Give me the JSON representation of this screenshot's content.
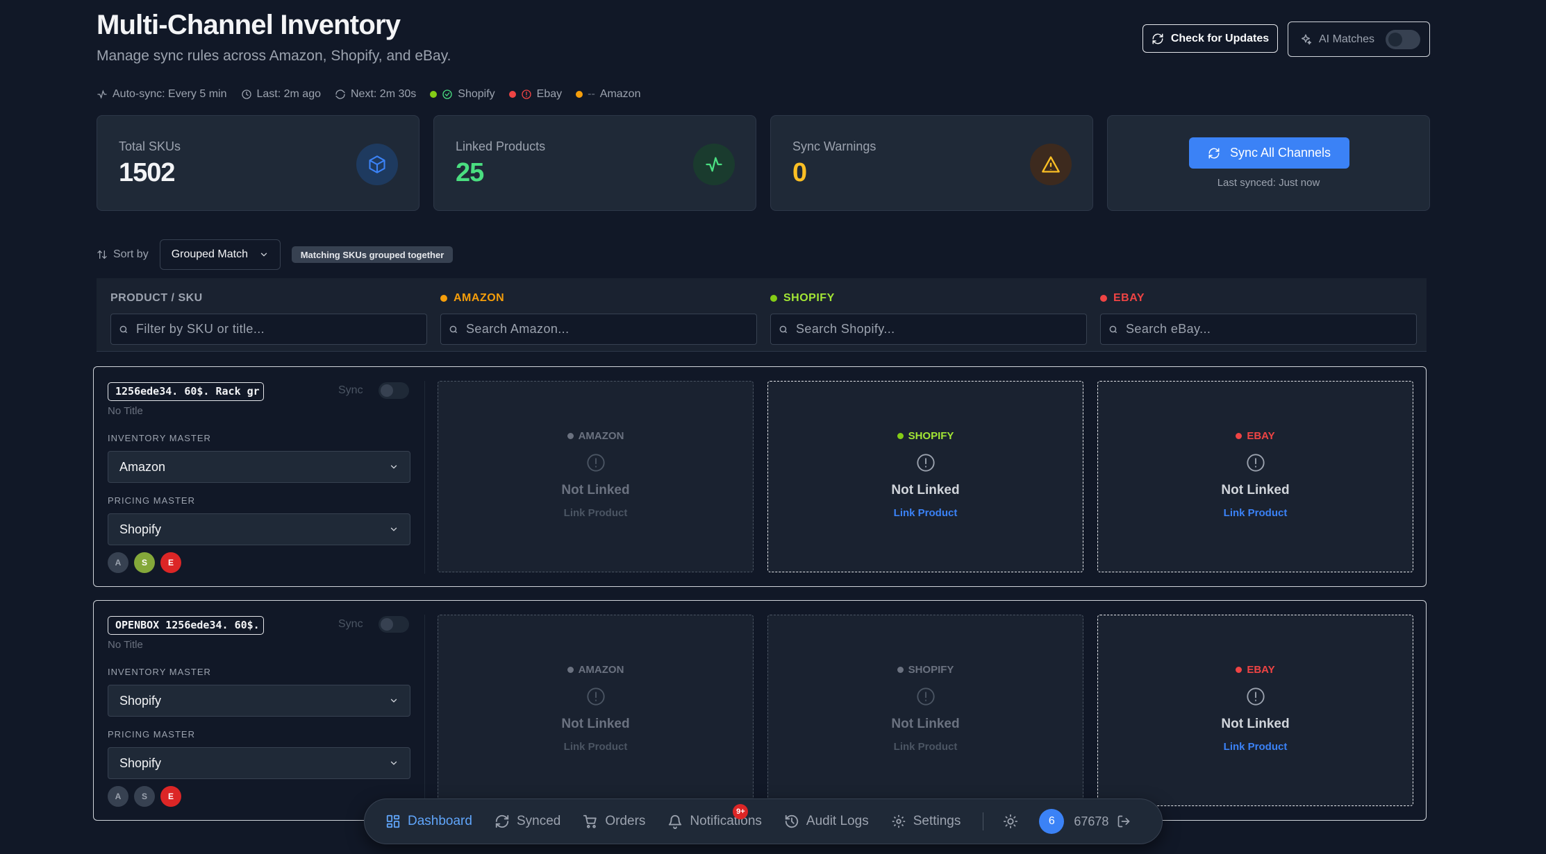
{
  "header": {
    "title": "Multi-Channel Inventory",
    "subtitle": "Manage sync rules across Amazon, Shopify, and eBay.",
    "check_updates_label": "Check for Updates",
    "ai_matches_label": "AI Matches"
  },
  "status": {
    "auto_sync": "Auto-sync: Every 5 min",
    "last": "Last: 2m ago",
    "next": "Next: 2m 30s",
    "shopify": "Shopify",
    "ebay": "Ebay",
    "amazon_prefix": "--",
    "amazon": "Amazon"
  },
  "stats": {
    "total_skus_label": "Total SKUs",
    "total_skus_value": "1502",
    "linked_label": "Linked Products",
    "linked_value": "25",
    "warnings_label": "Sync Warnings",
    "warnings_value": "0",
    "sync_all_label": "Sync All Channels",
    "last_synced": "Last synced: Just now"
  },
  "sort": {
    "label": "Sort by",
    "selected": "Grouped Match",
    "chip": "Matching SKUs grouped together"
  },
  "filters": {
    "product_head": "PRODUCT / SKU",
    "product_placeholder": "Filter by SKU or title...",
    "amazon_head": "AMAZON",
    "amazon_placeholder": "Search Amazon...",
    "shopify_head": "SHOPIFY",
    "shopify_placeholder": "Search Shopify...",
    "ebay_head": "EBAY",
    "ebay_placeholder": "Search eBay..."
  },
  "groups": [
    {
      "sku": "1256ede34. 60$. Rack gr",
      "sync_label": "Sync",
      "title": "No Title",
      "inventory_master_label": "INVENTORY MASTER",
      "inventory_master": "Amazon",
      "pricing_master_label": "PRICING MASTER",
      "pricing_master": "Shopify",
      "avatars": [
        "A",
        "S",
        "E"
      ],
      "slots": [
        {
          "channel": "AMAZON",
          "status": "Not Linked",
          "action": "Link Product"
        },
        {
          "channel": "SHOPIFY",
          "status": "Not Linked",
          "action": "Link Product"
        },
        {
          "channel": "EBAY",
          "status": "Not Linked",
          "action": "Link Product"
        }
      ]
    },
    {
      "sku": "OPENBOX 1256ede34. 60$.",
      "sync_label": "Sync",
      "title": "No Title",
      "inventory_master_label": "INVENTORY MASTER",
      "inventory_master": "Shopify",
      "pricing_master_label": "PRICING MASTER",
      "pricing_master": "Shopify",
      "avatars": [
        "A",
        "S",
        "E"
      ],
      "slots": [
        {
          "channel": "AMAZON",
          "status": "Not Linked",
          "action": "Link Product"
        },
        {
          "channel": "SHOPIFY",
          "status": "Not Linked",
          "action": "Link Product"
        },
        {
          "channel": "EBAY",
          "status": "Not Linked",
          "action": "Link Product"
        }
      ]
    }
  ],
  "nav": {
    "dashboard": "Dashboard",
    "synced": "Synced",
    "orders": "Orders",
    "notifications": "Notifications",
    "notifications_badge": "9+",
    "audit_logs": "Audit Logs",
    "settings": "Settings",
    "user_initial": "6",
    "user_name": "67678"
  },
  "colors": {
    "amazon": "#f59e0b",
    "shopify": "#84cc16",
    "ebay": "#ef4444",
    "accent": "#3b82f6",
    "linked": "#4ade80",
    "warning": "#fbbf24"
  }
}
